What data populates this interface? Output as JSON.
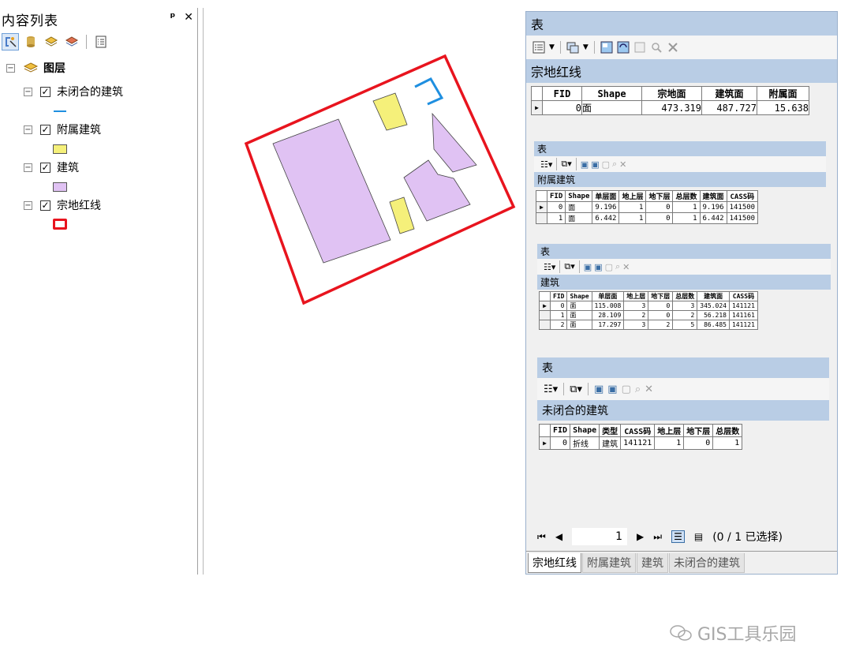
{
  "toc": {
    "title": "内容列表",
    "pin_icon": "pin-icon",
    "close_icon": "close-icon",
    "root_label": "图层",
    "layers": [
      {
        "label": "未闭合的建筑",
        "symbol": "line",
        "color": "#1f8fe0"
      },
      {
        "label": "附属建筑",
        "symbol": "fill",
        "color": "#f5f07a"
      },
      {
        "label": "建筑",
        "symbol": "fill",
        "color": "#e0c2f3"
      },
      {
        "label": "宗地红线",
        "symbol": "outline",
        "color": "#e8141e"
      }
    ]
  },
  "colors": {
    "parcel_outline": "#e8141e",
    "building_fill": "#e0c2f3",
    "annex_fill": "#f5f07a",
    "open_building_line": "#1f8fe0",
    "panel_header": "#b9cde5"
  },
  "table_window": {
    "window_title": "表",
    "main_table": {
      "name": "宗地红线",
      "columns": [
        "FID",
        "Shape",
        "宗地面",
        "建筑面",
        "附属面"
      ],
      "rows": [
        [
          "0",
          "面",
          "473.319",
          "487.727",
          "15.638"
        ]
      ]
    },
    "sub_tables": [
      {
        "window_title": "表",
        "name": "附属建筑",
        "columns": [
          "FID",
          "Shape",
          "单层面",
          "地上层",
          "地下层",
          "总层数",
          "建筑面",
          "CASS码"
        ],
        "rows": [
          [
            "0",
            "面",
            "9.196",
            "1",
            "0",
            "1",
            "9.196",
            "141500"
          ],
          [
            "1",
            "面",
            "6.442",
            "1",
            "0",
            "1",
            "6.442",
            "141500"
          ]
        ]
      },
      {
        "window_title": "表",
        "name": "建筑",
        "columns": [
          "FID",
          "Shape",
          "单层面",
          "地上层",
          "地下层",
          "总层数",
          "建筑面",
          "CASS码"
        ],
        "rows": [
          [
            "0",
            "面",
            "115.008",
            "3",
            "0",
            "3",
            "345.024",
            "141121"
          ],
          [
            "1",
            "面",
            "28.109",
            "2",
            "0",
            "2",
            "56.218",
            "141161"
          ],
          [
            "2",
            "面",
            "17.297",
            "3",
            "2",
            "5",
            "86.485",
            "141121"
          ]
        ]
      },
      {
        "window_title": "表",
        "name": "未闭合的建筑",
        "columns": [
          "FID",
          "Shape",
          "类型",
          "CASS码",
          "地上层",
          "地下层",
          "总层数"
        ],
        "rows": [
          [
            "0",
            "折线",
            "建筑",
            "141121",
            "1",
            "0",
            "1"
          ]
        ]
      }
    ],
    "nav": {
      "record": "1",
      "status": "(0 / 1 已选择)"
    },
    "tabs": [
      "宗地红线",
      "附属建筑",
      "建筑",
      "未闭合的建筑"
    ]
  },
  "watermark": "GIS工具乐园"
}
